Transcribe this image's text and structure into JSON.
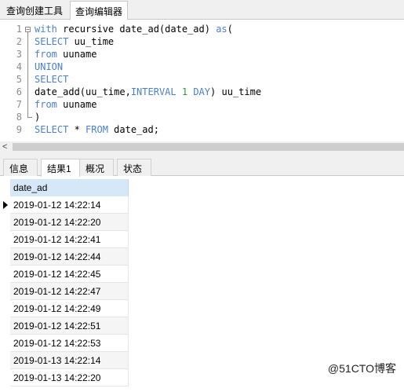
{
  "top_tabs": [
    {
      "label": "查询创建工具"
    },
    {
      "label": "查询编辑器"
    }
  ],
  "editor": {
    "lines": [
      {
        "num": "1",
        "segments": [
          {
            "t": "with",
            "c": "kw"
          },
          {
            "t": " recursive date_ad(date_ad) ",
            "c": ""
          },
          {
            "t": "as",
            "c": "kw"
          },
          {
            "t": "(",
            "c": ""
          }
        ]
      },
      {
        "num": "2",
        "segments": [
          {
            "t": "SELECT",
            "c": "kw"
          },
          {
            "t": " uu_time",
            "c": ""
          }
        ]
      },
      {
        "num": "3",
        "segments": [
          {
            "t": "from",
            "c": "kw"
          },
          {
            "t": " uuname",
            "c": ""
          }
        ]
      },
      {
        "num": "4",
        "segments": [
          {
            "t": "UNION",
            "c": "kw"
          }
        ]
      },
      {
        "num": "5",
        "segments": [
          {
            "t": "SELECT",
            "c": "kw"
          }
        ]
      },
      {
        "num": "6",
        "segments": [
          {
            "t": "date_add(uu_time,",
            "c": ""
          },
          {
            "t": "INTERVAL",
            "c": "kw"
          },
          {
            "t": " ",
            "c": ""
          },
          {
            "t": "1",
            "c": "num"
          },
          {
            "t": " ",
            "c": ""
          },
          {
            "t": "DAY",
            "c": "kw"
          },
          {
            "t": ") uu_time",
            "c": ""
          }
        ]
      },
      {
        "num": "7",
        "segments": [
          {
            "t": "from",
            "c": "kw"
          },
          {
            "t": " uuname",
            "c": ""
          }
        ]
      },
      {
        "num": "8",
        "segments": [
          {
            "t": ")",
            "c": ""
          }
        ]
      },
      {
        "num": "9",
        "segments": [
          {
            "t": "SELECT",
            "c": "kw"
          },
          {
            "t": " * ",
            "c": ""
          },
          {
            "t": "FROM",
            "c": "kw"
          },
          {
            "t": " date_ad;",
            "c": ""
          }
        ]
      }
    ]
  },
  "scrollbar": {
    "left_arrow": "<"
  },
  "result_tabs": [
    {
      "label": "信息"
    },
    {
      "label": "结果1"
    },
    {
      "label": "概况"
    },
    {
      "label": "状态"
    }
  ],
  "grid": {
    "column": "date_ad",
    "rows": [
      "2019-01-12 14:22:14",
      "2019-01-12 14:22:20",
      "2019-01-12 14:22:41",
      "2019-01-12 14:22:44",
      "2019-01-12 14:22:45",
      "2019-01-12 14:22:47",
      "2019-01-12 14:22:49",
      "2019-01-12 14:22:51",
      "2019-01-12 14:22:53",
      "2019-01-13 14:22:14",
      "2019-01-13 14:22:20"
    ]
  },
  "watermark": "@51CTO博客",
  "colors": {
    "keyword": "#4a7fd0",
    "number": "#2e9c3a",
    "header_bg": "#d6e8f7"
  }
}
